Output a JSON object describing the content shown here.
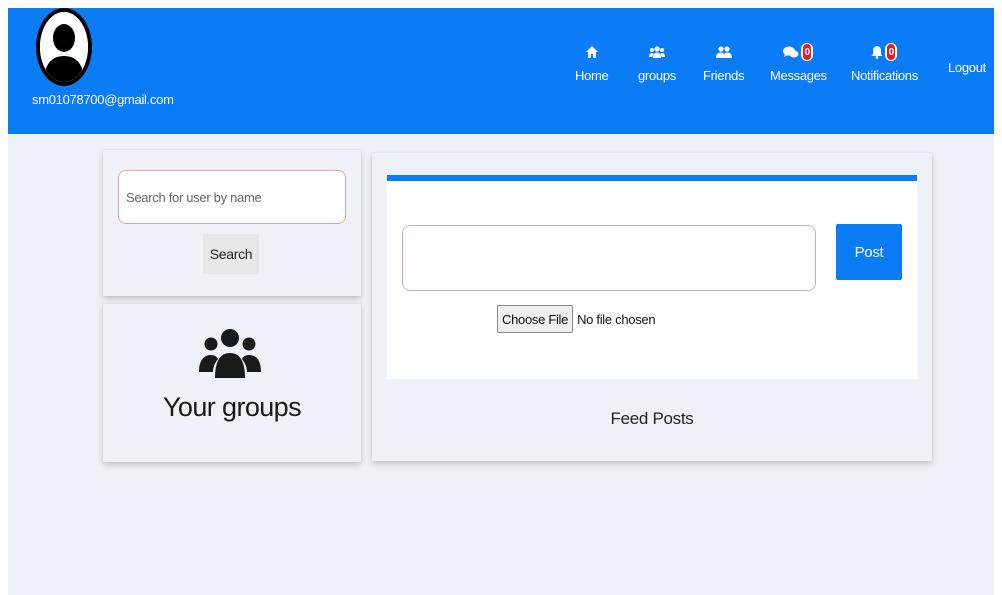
{
  "header": {
    "user_email": "sm01078700@gmail.com",
    "brand_color": "#0a7cf5",
    "nav": [
      {
        "id": "home",
        "label": "Home",
        "icon": "home-icon"
      },
      {
        "id": "groups",
        "label": "groups",
        "icon": "groups-icon"
      },
      {
        "id": "friends",
        "label": "Friends",
        "icon": "friends-icon"
      },
      {
        "id": "messages",
        "label": "Messages",
        "icon": "messages-icon",
        "badge": "0"
      },
      {
        "id": "notifications",
        "label": "Notifications",
        "icon": "bell-icon",
        "badge": "0"
      }
    ],
    "logout_label": "Logout"
  },
  "sidebar": {
    "search": {
      "placeholder": "Search for user by name",
      "button_label": "Search"
    },
    "groups": {
      "icon": "users-group-icon",
      "title": "Your groups"
    }
  },
  "feed": {
    "post_button_label": "Post",
    "choose_file_label": "Choose File",
    "file_status": "No file chosen",
    "title": "Feed Posts"
  },
  "colors": {
    "accent": "#0a7cf5",
    "background": "#eff1f8",
    "input_border": "#e9a4a0",
    "badge": "#e11d2a"
  }
}
